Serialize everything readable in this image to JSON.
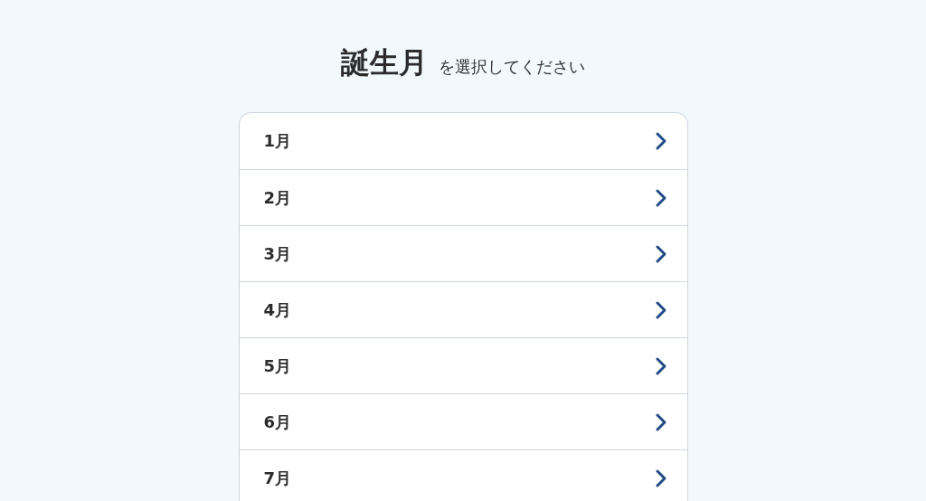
{
  "heading": {
    "title": "誕生月",
    "subtitle": "を選択してください"
  },
  "months": [
    {
      "label": "1月"
    },
    {
      "label": "2月"
    },
    {
      "label": "3月"
    },
    {
      "label": "4月"
    },
    {
      "label": "5月"
    },
    {
      "label": "6月"
    },
    {
      "label": "7月"
    }
  ]
}
